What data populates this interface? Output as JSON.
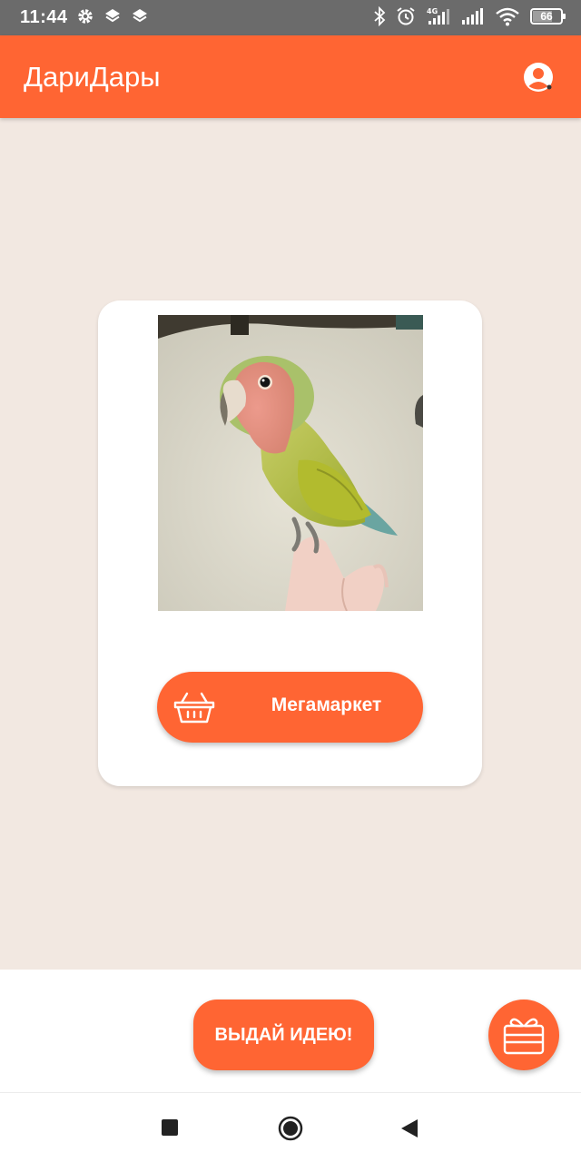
{
  "status_bar": {
    "time": "11:44",
    "left_icons": [
      "settings-icon",
      "layers-icon",
      "layers-icon"
    ],
    "right_icons": [
      "bluetooth-icon",
      "alarm-icon",
      "signal-4g-icon",
      "signal-icon",
      "wifi-icon"
    ],
    "battery_level": "66"
  },
  "app_bar": {
    "title": "ДариДары",
    "profile_icon": "account-circle-icon",
    "color": "#ff6533"
  },
  "card": {
    "image": "parrot-photo",
    "shop_button_label": "Мегамаркет",
    "shop_icon": "basket-icon"
  },
  "bottom": {
    "idea_button_label": "ВЫДАЙ ИДЕЮ!",
    "gift_icon": "gift-icon"
  },
  "nav_bar": {
    "recents_icon": "square-icon",
    "home_icon": "circle-icon",
    "back_icon": "triangle-back-icon"
  },
  "colors": {
    "accent": "#ff6533",
    "background": "#f2e8e1",
    "status_bar": "#6b6b6b"
  }
}
